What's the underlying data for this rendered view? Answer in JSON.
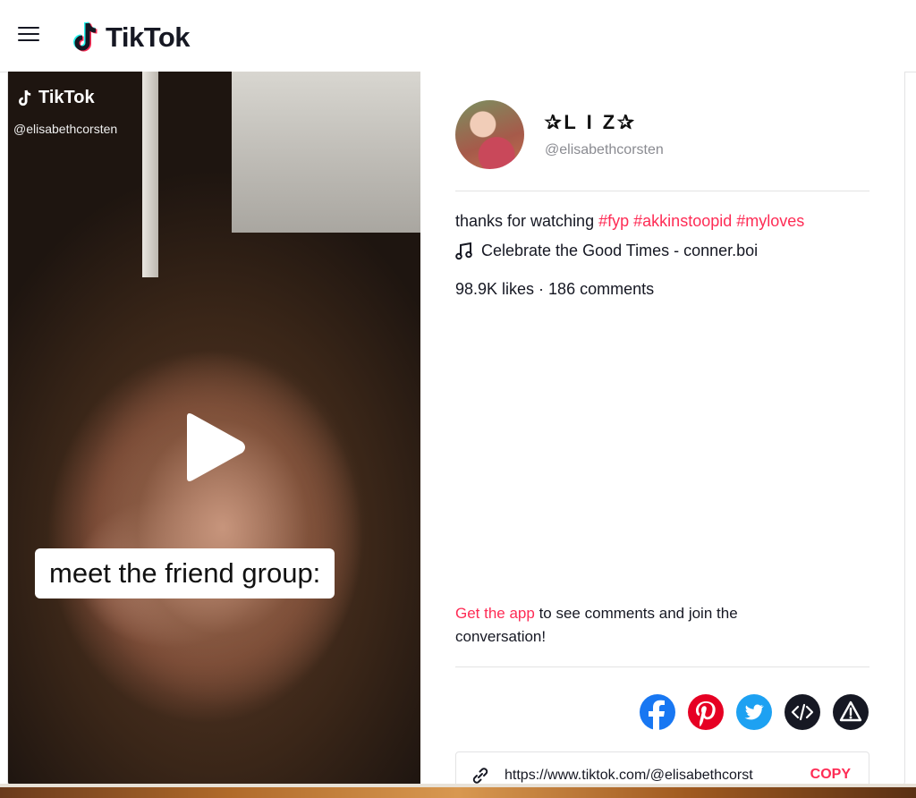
{
  "header": {
    "logo_text": "TikTok",
    "menu_icon": "hamburger-menu-icon"
  },
  "video": {
    "watermark_brand": "TikTok",
    "watermark_handle": "@elisabethcorsten",
    "caption_overlay": "meet the friend group:",
    "play_icon": "play-icon"
  },
  "author": {
    "nickname": "✰L I Z✰",
    "username": "@elisabethcorsten"
  },
  "post": {
    "description_text": "thanks for watching",
    "hashtags": [
      "#fyp",
      "#akkinstoopid",
      "#myloves"
    ],
    "music": "Celebrate the Good Times - conner.boi",
    "stats": "98.9K likes · 186 comments"
  },
  "get_app": {
    "link_text": "Get the app",
    "rest_text": "to see comments and join the conversation!"
  },
  "share": {
    "buttons": [
      "facebook-icon",
      "pinterest-icon",
      "twitter-icon",
      "embed-icon",
      "report-icon"
    ],
    "colors": {
      "facebook": "#1877f2",
      "pinterest": "#e60023",
      "twitter": "#1da1f2",
      "embed": "#161823",
      "report": "#161823"
    }
  },
  "link": {
    "url": "https://www.tiktok.com/@elisabethcorst",
    "copy_label": "COPY"
  },
  "colors": {
    "accent": "#fe2c55",
    "text": "#161823",
    "muted": "#8a8b91"
  }
}
